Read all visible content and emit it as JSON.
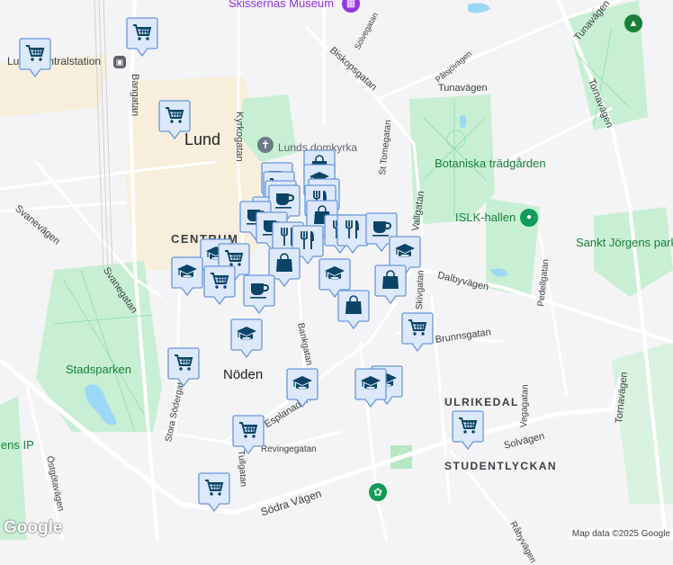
{
  "map": {
    "city": "Lund",
    "districts": [
      "CENTRUM",
      "Nöden",
      "ULRIKEDAL",
      "STUDENTLYCKAN"
    ],
    "pois": {
      "museum": "Skissernas Museum",
      "station": "Lund Centralstation",
      "cathedral": "Lunds domkyrka",
      "botanic": "Botaniska trädgården",
      "islk": "ISLK-hallen",
      "sankt": "Sankt Jörgens park",
      "stadsparken": "Stadsparken",
      "idrott": "Gårdens IP"
    },
    "roads": {
      "bangatan": "Bangatan",
      "kyrkogatan": "Kyrkogatan",
      "biskopsgatan": "Biskopsgatan",
      "solvegatan": "Sölvegatan",
      "palsjovagen": "Pålsjövägen",
      "tunavagen": "Tunavägen",
      "tunavagen2": "Tunavägen",
      "tornavagen": "Tornavägen",
      "tornavagen2": "Tornavägen",
      "sttomegatan": "St Tomegatan",
      "vallgatan": "Vallgatan",
      "svanevagen": "Svanevägen",
      "svanegatan": "Svanegatan",
      "dalbyvagen": "Dalbyvägen",
      "brunnsgatan": "Brunnsgatan",
      "bankgatan": "Bankgatan",
      "pedellgatan": "Pedellgatan",
      "vegagatan": "Vegagatan",
      "solvagen": "Solvägen",
      "revingegatan": "Revingegatan",
      "tullgatan": "Tullgatan",
      "sodravagen": "Södra Vägen",
      "storasodergatan": "Stora Södergatan",
      "ostgotavagen": "Östgötavägen",
      "esplanaden": "Esplanaden",
      "skivgatan": "Skivgatan",
      "rabyvagen": "Råbyvägen"
    },
    "attribution": "Map data ©2025 Google",
    "logo": "Google",
    "colors": {
      "marker_fill": "#dde8fb",
      "marker_border": "#6a96dc",
      "icon": "#0b4466",
      "park": "#c8efd4",
      "road": "#dadce0"
    }
  }
}
